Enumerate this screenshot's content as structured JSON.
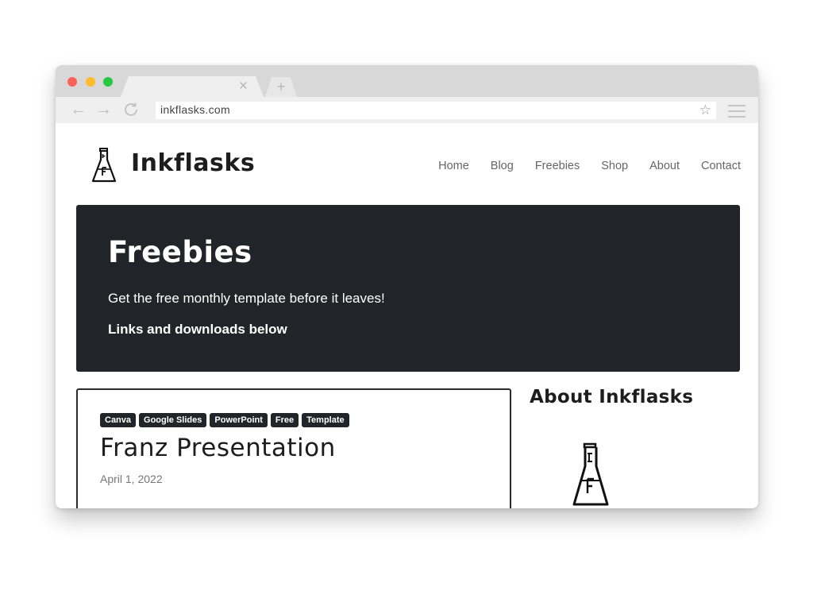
{
  "browser": {
    "tab_close": "×",
    "new_tab": "+",
    "url": "inkflasks.com"
  },
  "site": {
    "brand": "Inkflasks",
    "nav": [
      "Home",
      "Blog",
      "Freebies",
      "Shop",
      "About",
      "Contact"
    ]
  },
  "hero": {
    "title": "Freebies",
    "subtitle": "Get the free monthly template before it leaves!",
    "cta": "Links and downloads below"
  },
  "post": {
    "tags": [
      "Canva",
      "Google Slides",
      "PowerPoint",
      "Free",
      "Template"
    ],
    "title": "Franz Presentation",
    "date": "April 1, 2022"
  },
  "sidebar": {
    "title": "About Inkflasks"
  },
  "icons": {
    "back": "back-arrow-icon",
    "forward": "forward-arrow-icon",
    "reload": "reload-icon",
    "bookmark": "star-icon",
    "menu": "hamburger-menu-icon",
    "logo": "flask-logo-icon"
  },
  "colors": {
    "hero_bg": "#212428",
    "tag_bg": "#212428",
    "close_red": "#fe5f57",
    "minimize_yellow": "#fdbc2e",
    "maximize_green": "#28c840"
  }
}
